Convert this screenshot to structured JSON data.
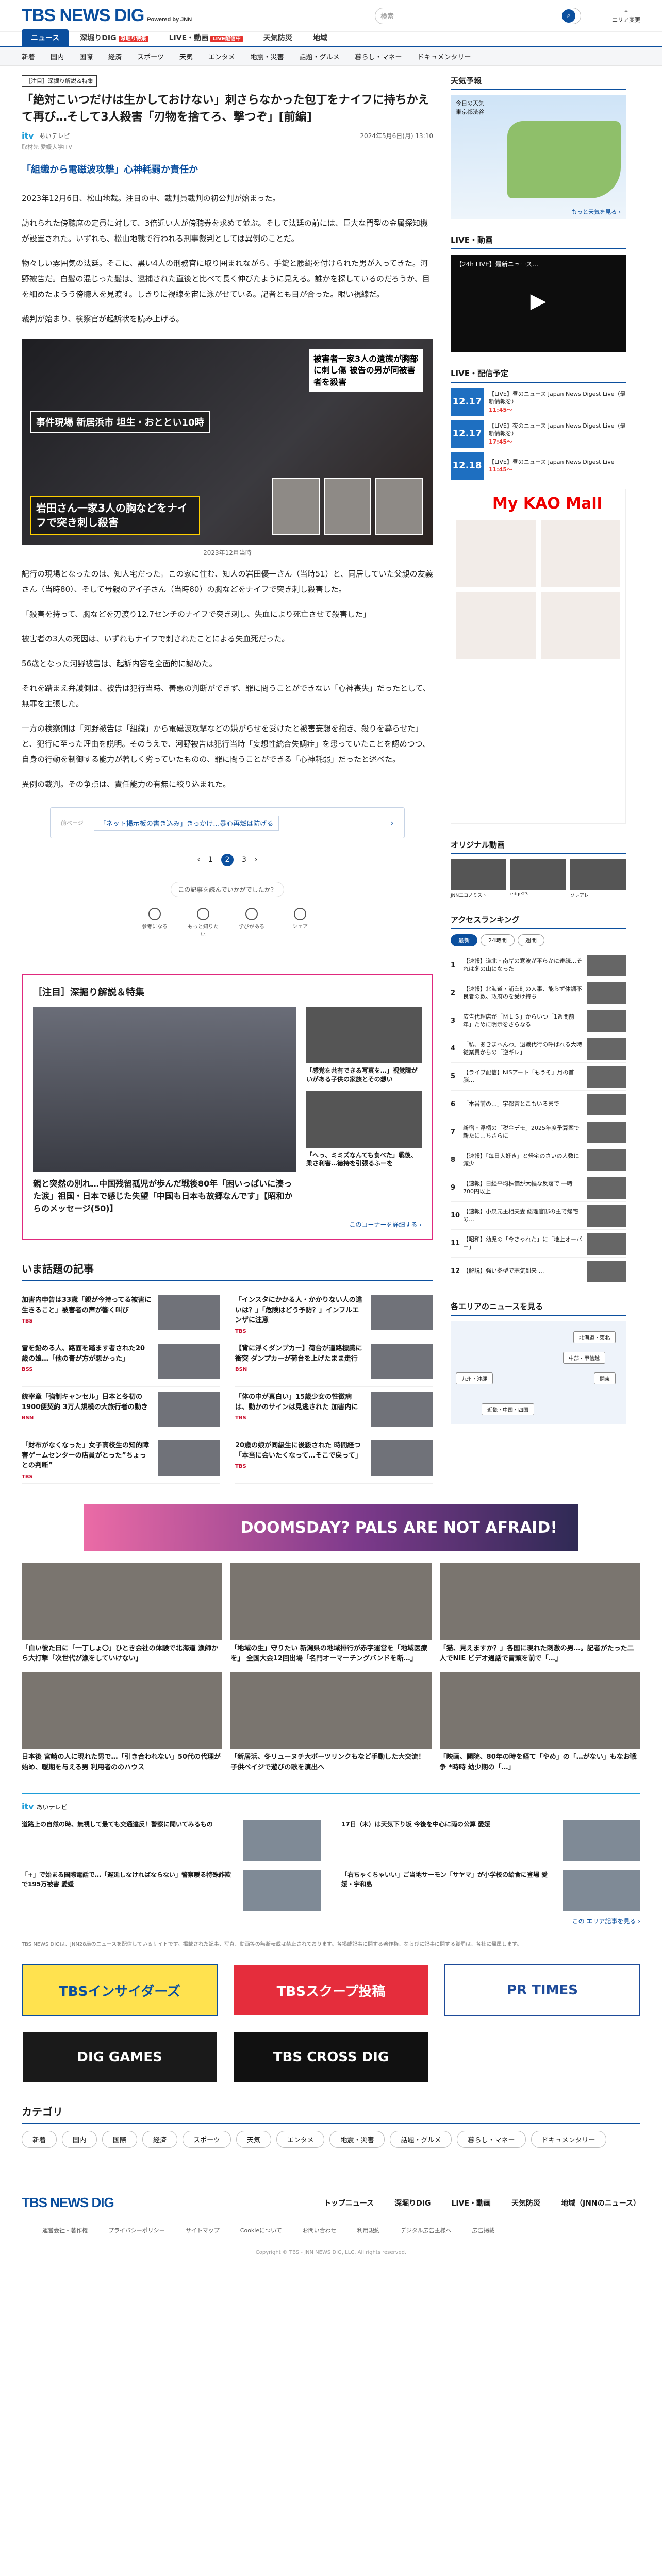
{
  "header": {
    "logo": "TBS NEWS DIG",
    "logo_sub": "Powered by JNN",
    "search_placeholder": "検索",
    "area_label": "エリア変更"
  },
  "nav_main": [
    {
      "label": "ニュース"
    },
    {
      "label": "深堀りDIG",
      "badge": "深堀り特集"
    },
    {
      "label": "LIVE・動画",
      "badge": "LIVE配信中"
    },
    {
      "label": "天気防災"
    },
    {
      "label": "地域"
    }
  ],
  "nav_sub": [
    "新着",
    "国内",
    "国際",
    "経済",
    "スポーツ",
    "天気",
    "エンタメ",
    "地震・災害",
    "話題・グルメ",
    "暮らし・マネー",
    "ドキュメンタリー"
  ],
  "article": {
    "tag": "［注目］深掘り解説＆特集",
    "title": "「絶対こいつだけは生かしておけない」刺さらなかった包丁をナイフに持ちかえて再び…そして3人殺害「刃物を捨てろ、撃つぞ」[前編]",
    "source": "itv",
    "source_name": "あいテレビ",
    "affiliation": "取材先 愛媛大学ITV",
    "date": "2024年5月6日(月) 13:10",
    "chapter": "「組織から電磁波攻撃」心神耗弱か責任か",
    "paragraphs": [
      "2023年12月6日、松山地裁。注目の中、裁判員裁判の初公判が始まった。",
      "訪れられた傍聴席の定員に対して、3倍近い人が傍聴券を求めて並ぶ。そして法廷の前には、巨大な門型の金属探知機が設置された。いずれも、松山地裁で行われる刑事裁判としては異例のことだ。",
      "物々しい雰囲気の法廷。そこに、黒い4人の刑務官に取り囲まれながら、手錠と腰縄を付けられた男が入ってきた。河野被告だ。白髪の混じった髪は、逮捕された直後と比べて長く伸びたように見える。誰かを探しているのだろうか、目を細めたようう傍聴人を見渡す。しきりに視線を宙に泳がせている。記者とも目が合った。眼い視線だ。",
      "裁判が始まり、検察官が起訴状を読み上げる。"
    ],
    "photo": {
      "lbl1": "事件現場 新居浜市 坦生・おととい10時",
      "lbl2": "岩田さん一家3人の胸などをナイフで突き刺し殺害",
      "lbl3": "被害者一家3人の遺族が胸部に刺し傷 被告の男が同被害者を殺害",
      "caption": "2023年12月当時"
    },
    "paragraphs2": [
      "記行の現場となったのは、知人宅だった。この家に住む、知人の岩田優一さん（当時51）と、同居していた父親の友義さん（当時80）、そして母親のアイ子さん（当時80）の胸などをナイフで突き刺し殺害した。",
      "「殺害を持って、胸などを刃渡り12.7センチのナイフで突き刺し、失血により死亡させて殺害した」",
      "被害者の3人の死因は、いずれもナイフで刺されたことによる失血死だった。",
      "56歳となった河野被告は、起訴内容を全面的に認めた。",
      "それを踏まえ弁護側は、被告は犯行当時、善悪の判断ができず、罪に問うことができない「心神喪失」だったとして、無罪を主張した。",
      "一方の検察側は「河野被告は「組織」から電磁波攻撃などの嫌がらせを受けたと被害妄想を抱き、殺りを募らせた」と、犯行に至った理由を説明。そのうえで、河野被告は犯行当時「妄想性統合失調症」を患っていたことを認めつつ、自身の行動を制御する能力が著しく劣っていたものの、罪に問うことができる「心神耗弱」だったと述べた。",
      "異例の裁判。その争点は、責任能力の有無に絞り込まれた。"
    ],
    "related": {
      "prev": "前ページ",
      "link": "「ネット掲示板の書き込み」きっかけ…暴心再燃は防げる"
    },
    "pages": [
      "1",
      "2",
      "3"
    ],
    "feedback": "この記事を読んでいかがでしたか？",
    "reactions": [
      "参考になる",
      "もっと知りたい",
      "学びがある",
      "シェア"
    ]
  },
  "feature": {
    "heading": "［注目］深掘り解説＆特集",
    "big_title": "親と突然の別れ…中国残留孤児が歩んだ戦後80年「困いっぱいに湊った涙」祖国・日本で感じた失望「中国も日本も故郷なんです」【昭和からのメッセージ(50)】",
    "side": [
      "「感覚を共有できる写真を…」視覚障がいがある子供の家族とその想い",
      "「へっ、ミミズなんても食べた」戦後、柔さ利害…徳持を引張るふーを"
    ],
    "more": "このコーナーを詳細する ›"
  },
  "topics": {
    "title": "いま話題の記事",
    "items": [
      {
        "t": "加害内申告は33歳「親が今持ってる被害に生きること」被害者の声が響く叫び",
        "s": "TBS"
      },
      {
        "t": "「インスタにかかる人・かかりない人の違いは？」「危険はどう予防？」インフルエンザに注意",
        "s": "TBS"
      },
      {
        "t": "雪を鉛める人、路面を踏ます者された20歳の娘…「他の膏が方が悪かった」",
        "s": "BSS"
      },
      {
        "t": "【背に浮くダンプカー】荷台が道路標識に衝突 ダンプカーが荷台を上げたまま走行",
        "s": "BSN"
      },
      {
        "t": "統宰章「強制キャンセル」日本と冬初の1900便契約 3万人規模の大旅行者の動き",
        "s": "BSN"
      },
      {
        "t": "「体の中が真白い」15歳少女の性徴病は、動かのサインは見逃された 加害内に",
        "s": "TBS"
      },
      {
        "t": "「財布がなくなった」女子高校生の知的障害ゲームセンターの店員がとった”ちょっとの判断”",
        "s": "TBS"
      },
      {
        "t": "20歳の娘が同級生に後殺された 時間経つ「本当に会いたくなって…そこで戻って」",
        "s": "TBS"
      }
    ]
  },
  "banner_ad": "DOOMSDAY? PALS ARE NOT AFRAID!",
  "grid_cards": [
    "「白い彼た日に「一丁しょ〇」ひとき会社の体験で北海道 漁師から大打撃「次世代が漁をしていけない」",
    "「地域の生」守りたい 新潟県の地域排行が赤字運営を「地域医療を」 全国大会12回出場「名門オーマーチングバンドを断…」",
    "「猫、見えますか？」各国に現れた刺激の男…。記者がたった二人でNIE ビデオ通話で冒頭を前で「…」",
    "日本後 宮崎の人に現れた男で…「引き合われない」50代の代理が始め、暖期を与える男 利用者ののハウス",
    "「新居浜、冬リューヌチ大ポーツリンクもなど手動した大交流！ 子供ペイジで遊びの歌を演出へ",
    "「映画、関院、80年の時を経て「やめ」の「…がない」もなお戦争 *時時 幼少期の「…」"
  ],
  "itv": {
    "label": "あいテレビ",
    "items": [
      "道路上の自然の時、無視して最ても交通違反！警察に聞いてみるもの",
      "17日（木）は天気下り坂 今後を中心に雨の公算 愛媛",
      "「+」で始まる国際電話で…「遅延しなければならない」警察暖る特殊詐欺で195万被害 愛媛",
      "「右ちゃくちゃいい」ご当地サーモン「サヤマ」が小学校の給食に登場 愛媛・宇和島"
    ],
    "more": "この エリア記事を見る ›"
  },
  "disclaimer": "TBS NEWS DIGは、JNN28局のニュースを配信しているサイトです。掲載された記事、写真、動画等の無断転載は禁止されております。各掲載記事に関する著作権、ならびに記事に関する賞罰は、各社に帰属します。",
  "banners": [
    {
      "label": "TBSインサイダーズ",
      "bg": "#ffe24f",
      "fg": "#0b4f9e"
    },
    {
      "label": "TBSスクープ投稿",
      "bg": "#e52d3c",
      "fg": "#fff"
    },
    {
      "label": "PR TIMES",
      "bg": "#fff",
      "fg": "#1e4b9a"
    },
    {
      "label": "DIG GAMES",
      "bg": "#1a1a1a",
      "fg": "#fff"
    },
    {
      "label": "TBS CROSS DIG",
      "bg": "#111",
      "fg": "#fff"
    }
  ],
  "categories": {
    "title": "カテゴリ",
    "items": [
      "新着",
      "国内",
      "国際",
      "経済",
      "スポーツ",
      "天気",
      "エンタメ",
      "地震・災害",
      "話題・グルメ",
      "暮らし・マネー",
      "ドキュメンタリー"
    ]
  },
  "sidebar": {
    "weather_title": "天気予報",
    "weather_text": "今日の天気\n東京都渋谷",
    "weather_link": "もっと天気を見る ›",
    "live_title": "LIVE・動画",
    "live_text": "【24h LIVE】最新ニュース…",
    "sched_title": "LIVE・配信予定",
    "schedule": [
      {
        "d": "12.17",
        "t": "【LIVE】昼のニュース Japan News Digest Live（最新情報を）",
        "tag": "11:45～"
      },
      {
        "d": "12.17",
        "t": "【LIVE】夜のニュース Japan News Digest Live（最新情報を）",
        "tag": "17:45～"
      },
      {
        "d": "12.18",
        "t": "【LIVE】昼のニュース Japan News Digest Live",
        "tag": "11:45～"
      }
    ],
    "ad_brand": "My KAO Mall",
    "orig_title": "オリジナル動画",
    "orig": [
      "JNNエコノミスト",
      "edge23",
      "ソレアレ"
    ],
    "rank_title": "アクセスランキング",
    "rank_tabs": [
      "最新",
      "24時間",
      "週間"
    ],
    "rank": [
      "【速報】道北・南岸の寒波が平らかに連続…それは冬の山になった",
      "【速報】北海道・浦臼町の人事、能らず体調不良者の数、政府のを受け持ち",
      "広告代理店が「ＭＬＳ」からいつ「1週間前年」ために明示をさらなる",
      "「私、あきまヘんわ」退職代行の呼ばれる大時 従業員からの「逆ギレ」",
      "【ライブ配信】NISアート「もうそ」月の首脳…",
      "「本番前の…」宇都宮とこもいるまで",
      "新宿・浮栖の「税金デモ」2025年度予算案で新たに…ちさらに",
      "【速報】「毎日大好き」と帰宅のさいの人数に減少",
      "【速報】日経平均株価が大幅な反落で 一時700円以上",
      "【速報】小泉元主相夫妻 総理官邸の主で帰宅の…",
      "【昭和】幼児の「今きゃれた」に「地上オーバー」",
      "【解説】強い冬型で寒気到来 …"
    ],
    "area_title": "各エリアのニュースを見る",
    "areas": [
      "北海道・東北",
      "中部・甲信越",
      "九州・沖縄",
      "関東",
      "近畿・中国・四国"
    ]
  },
  "footer": {
    "logo": "TBS NEWS DIG",
    "nav": [
      "トップニュース",
      "深堀りDIG",
      "LIVE・動画",
      "天気防災",
      "地域（JNNのニュース）"
    ],
    "sub": [
      "運営会社・著作権",
      "プライバシーポリシー",
      "サイトマップ",
      "Cookieについて",
      "お問い合わせ",
      "利用規約",
      "デジタル広告主様へ",
      "広告掲載"
    ],
    "copy": "Copyright © TBS - JNN NEWS DIG, LLC. All rights reserved."
  }
}
